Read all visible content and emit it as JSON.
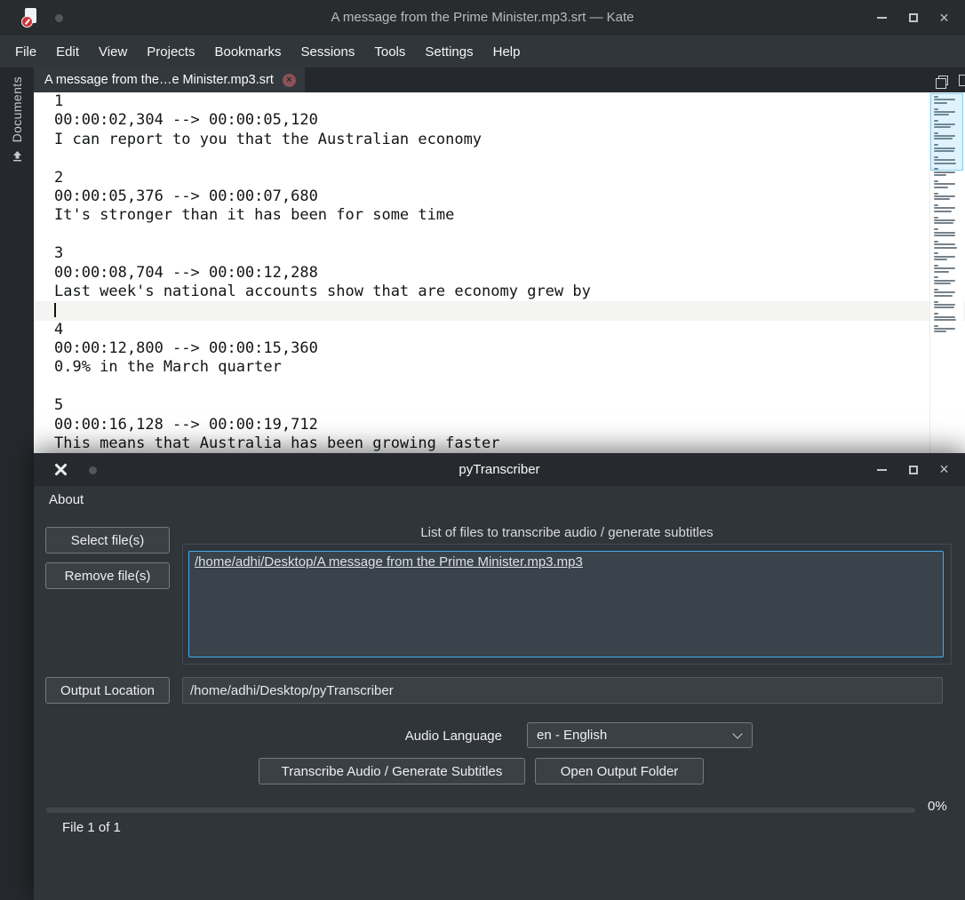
{
  "icons": {
    "close_glyph": "×"
  },
  "colors": {
    "accent": "#3daee9"
  },
  "kate": {
    "titlebar": {
      "title": "A message from the Prime Minister.mp3.srt — Kate"
    },
    "menu": {
      "items": [
        "File",
        "Edit",
        "View",
        "Projects",
        "Bookmarks",
        "Sessions",
        "Tools",
        "Settings",
        "Help"
      ]
    },
    "tab": {
      "label": "A message from the…e Minister.mp3.srt"
    },
    "sidebar": {
      "label": "Documents"
    },
    "editor": {
      "lines": [
        {
          "text": "1"
        },
        {
          "text": "00:00:02,304 --> 00:00:05,120"
        },
        {
          "text": "I can report to you that the Australian economy"
        },
        {
          "text": ""
        },
        {
          "text": "2"
        },
        {
          "text": "00:00:05,376 --> 00:00:07,680"
        },
        {
          "text": "It's stronger than it has been for some time"
        },
        {
          "text": ""
        },
        {
          "text": "3"
        },
        {
          "text": "00:00:08,704 --> 00:00:12,288"
        },
        {
          "text": "Last week's national accounts show that are economy grew by"
        },
        {
          "text": "",
          "current": true
        },
        {
          "text": "4"
        },
        {
          "text": "00:00:12,800 --> 00:00:15,360"
        },
        {
          "text": "0.9% in the March quarter"
        },
        {
          "text": ""
        },
        {
          "text": "5"
        },
        {
          "text": "00:00:16,128 --> 00:00:19,712"
        },
        {
          "text": "This means that Australia has been growing faster"
        }
      ]
    }
  },
  "pytranscriber": {
    "titlebar": {
      "title": "pyTranscriber"
    },
    "menu": {
      "about": "About"
    },
    "select_files": "Select file(s)",
    "remove_files": "Remove file(s)",
    "files_group_title": "List of files to transcribe audio / generate subtitles",
    "file_list": [
      "/home/adhi/Desktop/A message from the Prime Minister.mp3.mp3"
    ],
    "output_location_button": "Output Location",
    "output_location_value": "/home/adhi/Desktop/pyTranscriber",
    "audio_language_label": "Audio Language",
    "audio_language_value": "en - English",
    "transcribe_button": "Transcribe Audio / Generate Subtitles",
    "open_output_button": "Open Output Folder",
    "progress_percent": "0%",
    "file_counter": "File 1 of 1"
  }
}
